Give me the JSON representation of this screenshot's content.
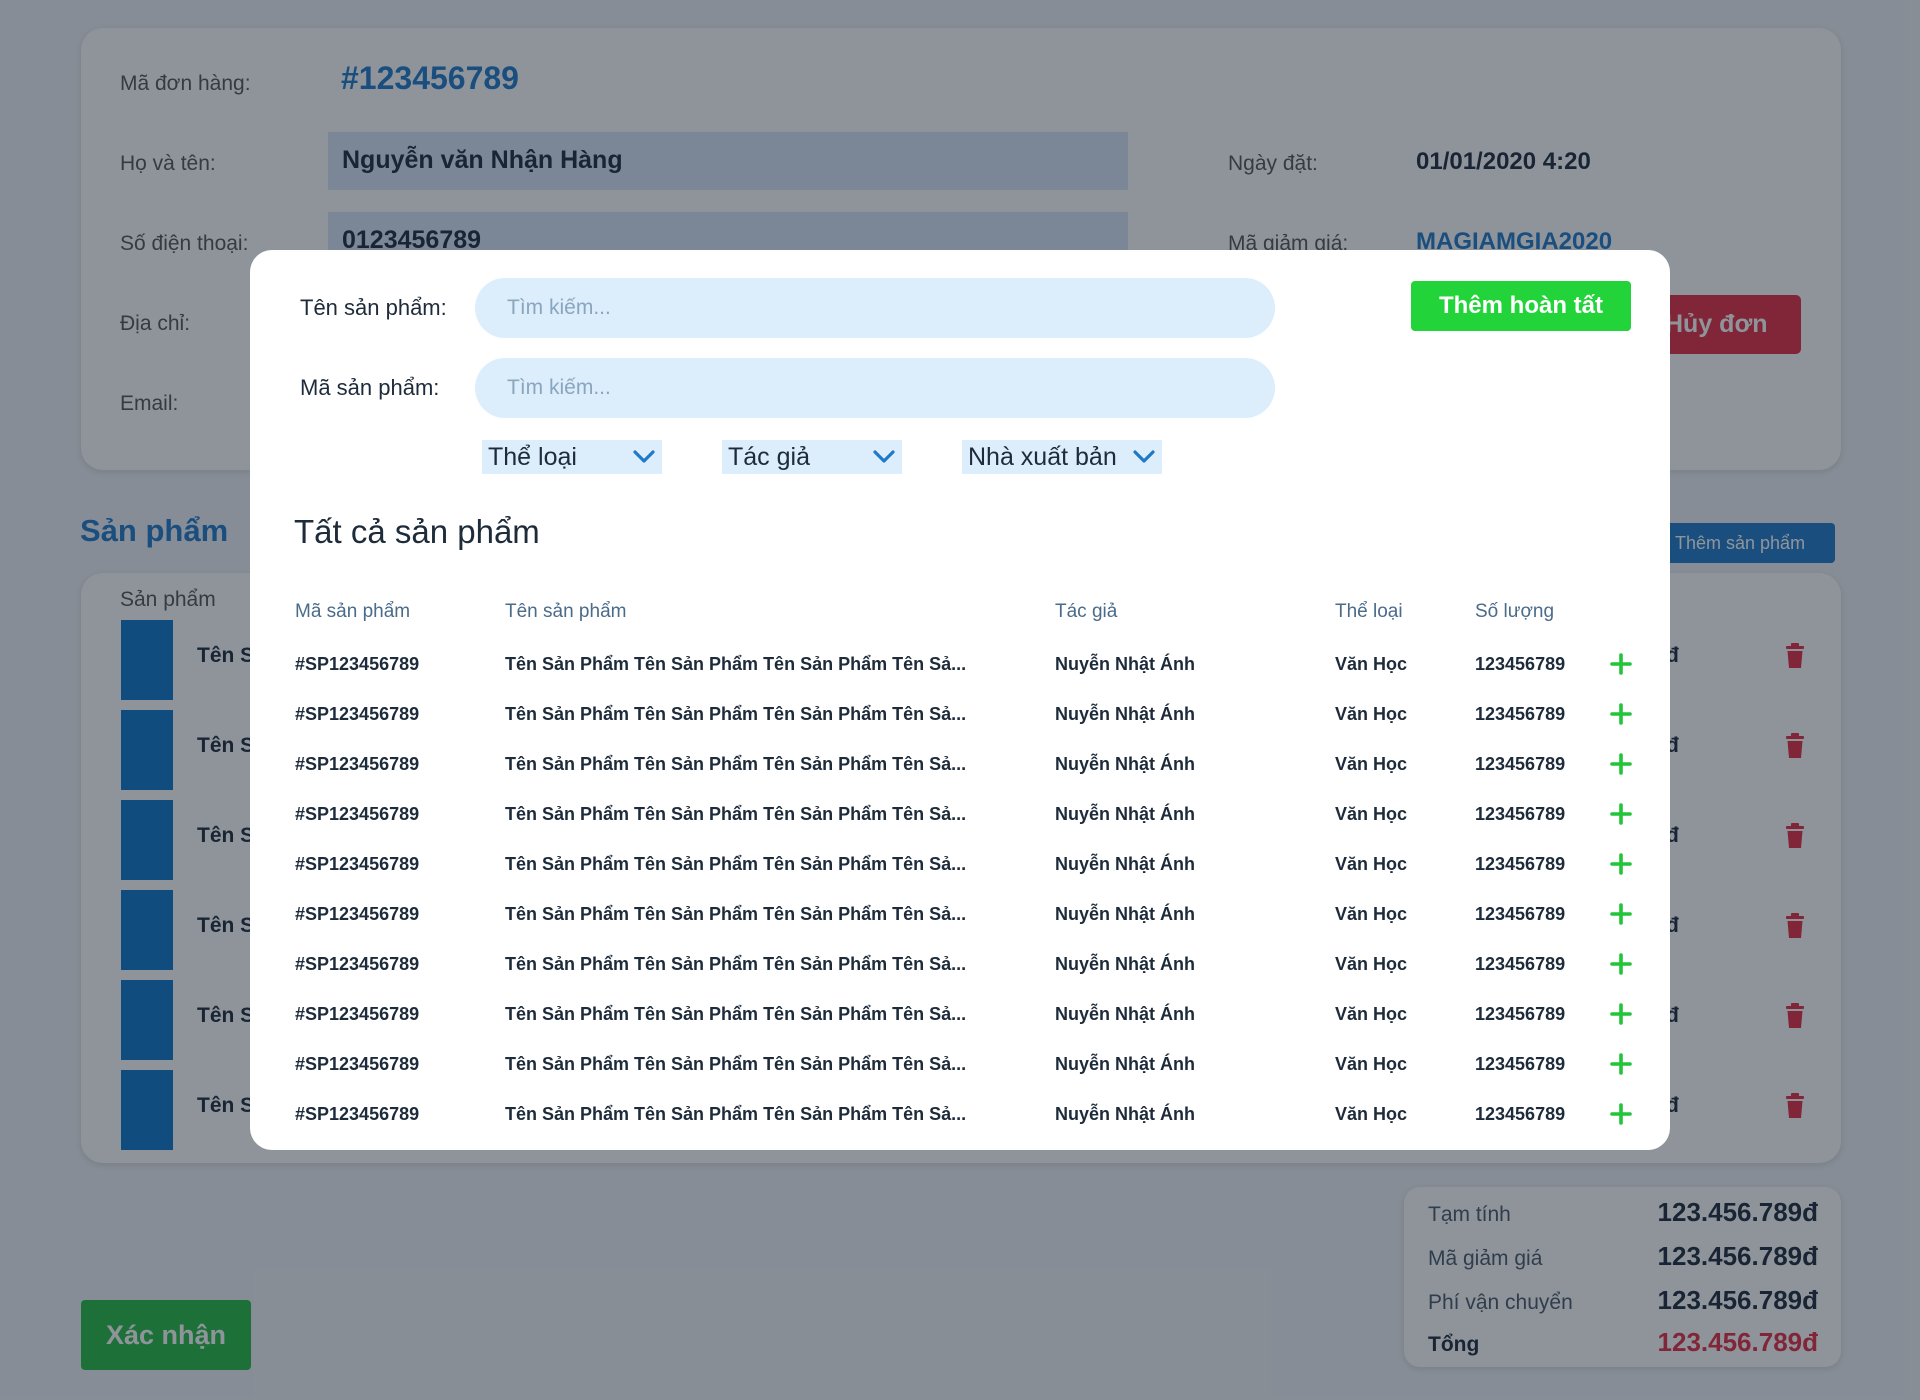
{
  "order": {
    "id_label": "Mã đơn hàng:",
    "id_value": "#123456789",
    "name_label": "Họ và tên:",
    "name_value": "Nguyễn văn Nhận Hàng",
    "phone_label": "Số điện thoại:",
    "phone_value": "0123456789",
    "address_label": "Địa chỉ:",
    "email_label": "Email:",
    "date_label": "Ngày đặt:",
    "date_value": "01/01/2020 4:20",
    "coupon_label": "Mã giảm giá:",
    "coupon_value": "MAGIAMGIA2020",
    "cancel_button": "Hủy đơn"
  },
  "products": {
    "section_title": "Sản phẩm",
    "add_button": "Thêm sản phẩm",
    "column_header": "Sản phẩm",
    "rows": [
      {
        "name": "Tên S",
        "price": "đ"
      },
      {
        "name": "Tên S",
        "price": "đ"
      },
      {
        "name": "Tên S",
        "price": "đ"
      },
      {
        "name": "Tên S",
        "price": "đ"
      },
      {
        "name": "Tên S",
        "price": "đ"
      },
      {
        "name": "Tên S",
        "price": "đ"
      }
    ]
  },
  "summary": {
    "subtotal_label": "Tạm tính",
    "subtotal_value": "123.456.789đ",
    "discount_label": "Mã giảm giá",
    "discount_value": "123.456.789đ",
    "shipping_label": "Phí vận chuyển",
    "shipping_value": "123.456.789đ",
    "total_label": "Tổng",
    "total_value": "123.456.789đ"
  },
  "confirm_button": "Xác nhận",
  "modal": {
    "name_search_label": "Tên sản phẩm:",
    "name_search_placeholder": "Tìm kiếm...",
    "code_search_label": "Mã sản phẩm:",
    "code_search_placeholder": "Tìm kiếm...",
    "done_button": "Thêm hoàn tất",
    "filters": {
      "category": "Thể loại",
      "author": "Tác giả",
      "publisher": "Nhà xuất bản"
    },
    "title": "Tất cả sản phẩm",
    "columns": {
      "code": "Mã sản phẩm",
      "name": "Tên sản phẩm",
      "author": "Tác giả",
      "category": "Thể loại",
      "quantity": "Số lượng"
    },
    "rows": [
      {
        "code": "#SP123456789",
        "name": "Tên Sản Phẩm Tên Sản Phẩm Tên Sản Phẩm Tên Sả...",
        "author": "Nuyễn Nhật Ánh",
        "category": "Văn Học",
        "quantity": "123456789"
      },
      {
        "code": "#SP123456789",
        "name": "Tên Sản Phẩm Tên Sản Phẩm Tên Sản Phẩm Tên Sả...",
        "author": "Nuyễn Nhật Ánh",
        "category": "Văn Học",
        "quantity": "123456789"
      },
      {
        "code": "#SP123456789",
        "name": "Tên Sản Phẩm Tên Sản Phẩm Tên Sản Phẩm Tên Sả...",
        "author": "Nuyễn Nhật Ánh",
        "category": "Văn Học",
        "quantity": "123456789"
      },
      {
        "code": "#SP123456789",
        "name": "Tên Sản Phẩm Tên Sản Phẩm Tên Sản Phẩm Tên Sả...",
        "author": "Nuyễn Nhật Ánh",
        "category": "Văn Học",
        "quantity": "123456789"
      },
      {
        "code": "#SP123456789",
        "name": "Tên Sản Phẩm Tên Sản Phẩm Tên Sản Phẩm Tên Sả...",
        "author": "Nuyễn Nhật Ánh",
        "category": "Văn Học",
        "quantity": "123456789"
      },
      {
        "code": "#SP123456789",
        "name": "Tên Sản Phẩm Tên Sản Phẩm Tên Sản Phẩm Tên Sả...",
        "author": "Nuyễn Nhật Ánh",
        "category": "Văn Học",
        "quantity": "123456789"
      },
      {
        "code": "#SP123456789",
        "name": "Tên Sản Phẩm Tên Sản Phẩm Tên Sản Phẩm Tên Sả...",
        "author": "Nuyễn Nhật Ánh",
        "category": "Văn Học",
        "quantity": "123456789"
      },
      {
        "code": "#SP123456789",
        "name": "Tên Sản Phẩm Tên Sản Phẩm Tên Sản Phẩm Tên Sả...",
        "author": "Nuyễn Nhật Ánh",
        "category": "Văn Học",
        "quantity": "123456789"
      },
      {
        "code": "#SP123456789",
        "name": "Tên Sản Phẩm Tên Sản Phẩm Tên Sản Phẩm Tên Sả...",
        "author": "Nuyễn Nhật Ánh",
        "category": "Văn Học",
        "quantity": "123456789"
      },
      {
        "code": "#SP123456789",
        "name": "Tên Sản Phẩm Tên Sản Phẩm Tên Sản Phẩm Tên Sả...",
        "author": "Nuyễn Nhật Ánh",
        "category": "Văn Học",
        "quantity": "123456789"
      }
    ]
  },
  "colors": {
    "accent": "#1e7ac8",
    "danger": "#e42c41",
    "success": "#26bd42",
    "success_bright": "#22d43a",
    "field_bg": "#dcedfb"
  },
  "icons": {
    "row_delete": "trash-icon",
    "row_add": "plus-icon",
    "dropdown": "chevron-down-icon"
  }
}
